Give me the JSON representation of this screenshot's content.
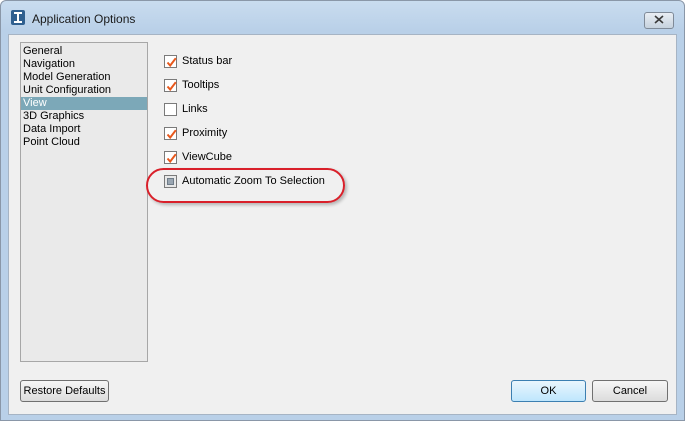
{
  "window": {
    "title": "Application Options",
    "close_icon": "close-icon",
    "app_icon": "autodesk-i-icon"
  },
  "sidebar": {
    "items": [
      {
        "label": "General",
        "selected": false
      },
      {
        "label": "Navigation",
        "selected": false
      },
      {
        "label": "Model Generation",
        "selected": false
      },
      {
        "label": "Unit Configuration",
        "selected": false
      },
      {
        "label": "View",
        "selected": true
      },
      {
        "label": "3D Graphics",
        "selected": false
      },
      {
        "label": "Data Import",
        "selected": false
      },
      {
        "label": "Point Cloud",
        "selected": false
      }
    ]
  },
  "options": [
    {
      "label": "Status bar",
      "state": "checked"
    },
    {
      "label": "Tooltips",
      "state": "checked"
    },
    {
      "label": "Links",
      "state": "unchecked"
    },
    {
      "label": "Proximity",
      "state": "checked"
    },
    {
      "label": "ViewCube",
      "state": "checked"
    },
    {
      "label": "Automatic Zoom To Selection",
      "state": "indeterminate"
    }
  ],
  "buttons": {
    "restore_defaults": "Restore Defaults",
    "ok": "OK",
    "cancel": "Cancel"
  },
  "colors": {
    "selection": "#7ca8b8",
    "checkmark": "#e8581c",
    "highlight_ellipse": "#d9202a"
  }
}
